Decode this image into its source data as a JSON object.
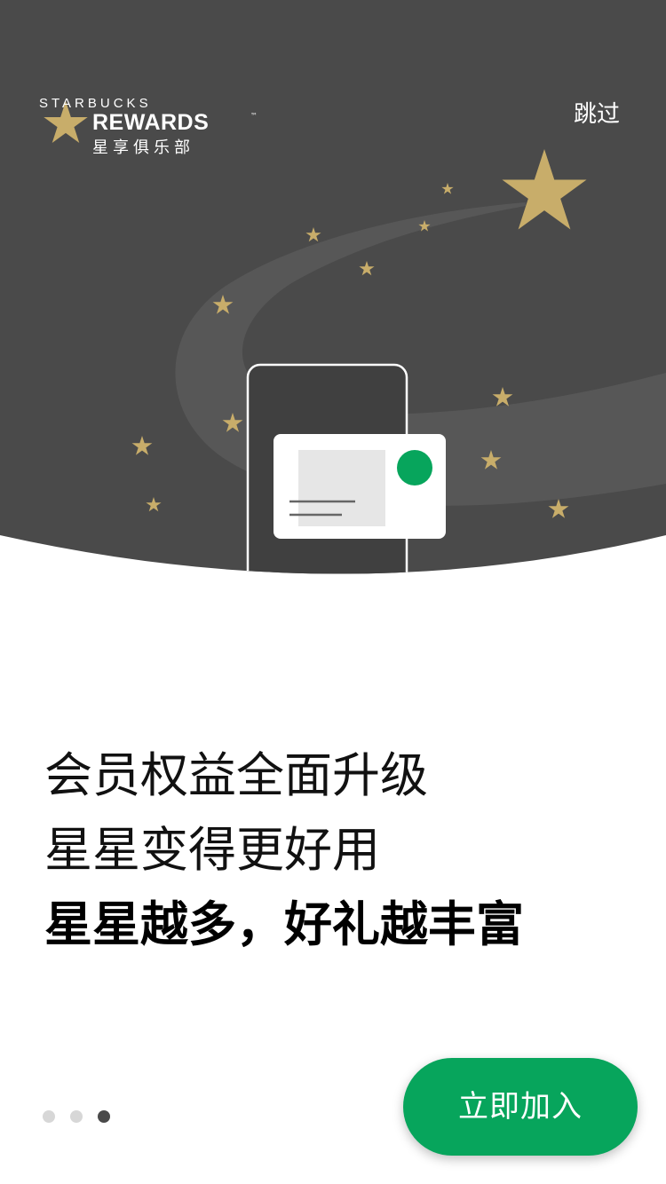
{
  "header": {
    "brand_top": "STARBUCKS",
    "brand_main": "REWARDS",
    "brand_tm": "™",
    "brand_cn": "星享俱乐部",
    "skip_label": "跳过"
  },
  "headline": {
    "line1": "会员权益全面升级",
    "line2": "星星变得更好用",
    "line3": "星星越多，好礼越丰富"
  },
  "pager": {
    "total": 3,
    "active_index": 3
  },
  "cta": {
    "label": "立即加入"
  },
  "colors": {
    "hero_background": "#4a4a4a",
    "star_gold": "#c8ad6a",
    "brand_green": "#07a55c",
    "text_dark": "#111111"
  },
  "icons": {
    "logo": "starbucks-star-logo-icon",
    "stars": "gold-star-icon",
    "phone": "phone-illustration-icon",
    "card": "member-card-icon"
  }
}
